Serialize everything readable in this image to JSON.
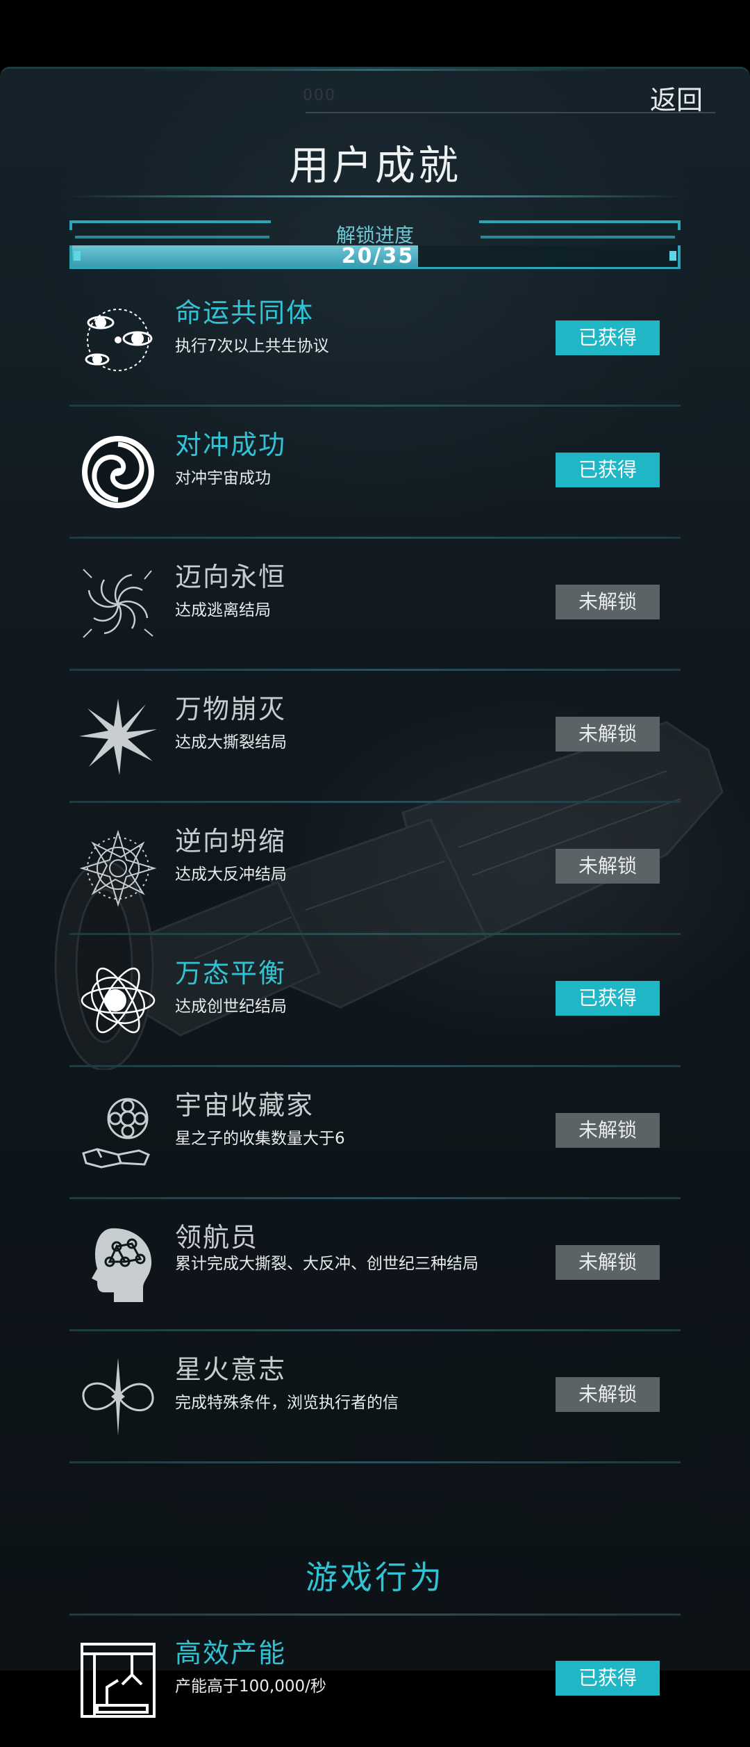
{
  "header": {
    "back_label": "返回",
    "title": "用户成就",
    "faint_text": "000"
  },
  "progress": {
    "label": "解锁进度",
    "text": "20/35",
    "unlocked": 20,
    "total": 35
  },
  "achievements": [
    {
      "name": "命运共同体",
      "desc": "执行7次以上共生协议",
      "status": "已获得",
      "icon": "orbit-planets-icon"
    },
    {
      "name": "对冲成功",
      "desc": "对冲宇宙成功",
      "status": "已获得",
      "icon": "swirl-circle-icon"
    },
    {
      "name": "迈向永恒",
      "desc": "达成逃离结局",
      "status": "未解锁",
      "icon": "vortex-icon"
    },
    {
      "name": "万物崩灭",
      "desc": "达成大撕裂结局",
      "status": "未解锁",
      "icon": "starburst-icon"
    },
    {
      "name": "逆向坍缩",
      "desc": "达成大反冲结局",
      "status": "未解锁",
      "icon": "mandala-icon"
    },
    {
      "name": "万态平衡",
      "desc": "达成创世纪结局",
      "status": "已获得",
      "icon": "atom-icon"
    },
    {
      "name": "宇宙收藏家",
      "desc": "星之子的收集数量大于6",
      "status": "未解锁",
      "icon": "collector-icon"
    },
    {
      "name": "领航员",
      "desc": "累计完成大撕裂、大反冲、创世纪三种结局",
      "status": "未解锁",
      "icon": "brain-head-icon"
    },
    {
      "name": "星火意志",
      "desc": "完成特殊条件，浏览执行者的信",
      "status": "未解锁",
      "icon": "infinity-star-icon"
    }
  ],
  "section": {
    "title": "游戏行为"
  },
  "behavior": [
    {
      "name": "高效产能",
      "desc": "产能高于100,000/秒",
      "status": "已获得",
      "icon": "factory-arm-icon"
    }
  ],
  "colors": {
    "accent": "#31c3d4",
    "badge_got": "#1fb6c6",
    "badge_locked": "#5c6366"
  }
}
